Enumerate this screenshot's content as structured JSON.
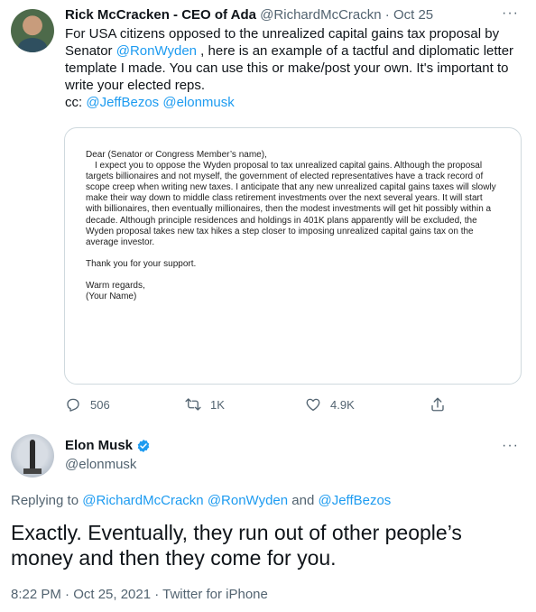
{
  "tweet1": {
    "author_name": "Rick McCracken - CEO of Ada",
    "handle": "@RichardMcCrackn",
    "separator": "·",
    "date": "Oct 25",
    "more": "···",
    "text_part1": "For USA citizens opposed to the unrealized capital gains tax proposal by Senator ",
    "mention1": "@RonWyden",
    "text_part2": " , here is an example of a tactful and diplomatic letter template I made. You can use this or make/post your own. It's important to write your elected reps.",
    "cc_label": "cc: ",
    "mention2": "@JeffBezos",
    "mention3": "@elonmusk",
    "letter": {
      "salutation": "Dear (Senator or Congress Member’s name),",
      "body": "I expect you to oppose the Wyden proposal to tax unrealized capital gains. Although the proposal targets billionaires and not myself, the government of elected representatives have a track record of scope creep when writing new taxes. I anticipate that any new unrealized capital gains taxes will slowly make their way down to middle class retirement investments over the next several years. It will start with billionaires, then eventually millionaires, then the modest investments will get hit possibly within a decade. Although principle residences and holdings in 401K plans apparently will be excluded, the Wyden proposal takes new tax hikes a step closer to imposing unrealized capital gains tax on the average investor.",
      "thanks": "Thank you for your support.",
      "closing": "Warm regards,",
      "signature": "(Your Name)"
    },
    "actions": {
      "replies": "506",
      "retweets": "1K",
      "likes": "4.9K"
    }
  },
  "tweet2": {
    "author_name": "Elon Musk",
    "handle": "@elonmusk",
    "more": "···",
    "replying_label": "Replying to ",
    "reply_mention1": "@RichardMcCrackn",
    "reply_mention2": "@RonWyden",
    "reply_and": " and ",
    "reply_mention3": "@JeffBezos",
    "text": "Exactly. Eventually, they run out of other people’s money and then they come for you.",
    "meta": "8:22 PM · Oct 25, 2021 · Twitter for iPhone"
  },
  "colors": {
    "link": "#1d9bf0",
    "secondary_text": "#536471",
    "border": "#cfd9de"
  },
  "icons": [
    "reply-icon",
    "retweet-icon",
    "like-icon",
    "share-icon",
    "verified-badge-icon",
    "more-icon"
  ]
}
